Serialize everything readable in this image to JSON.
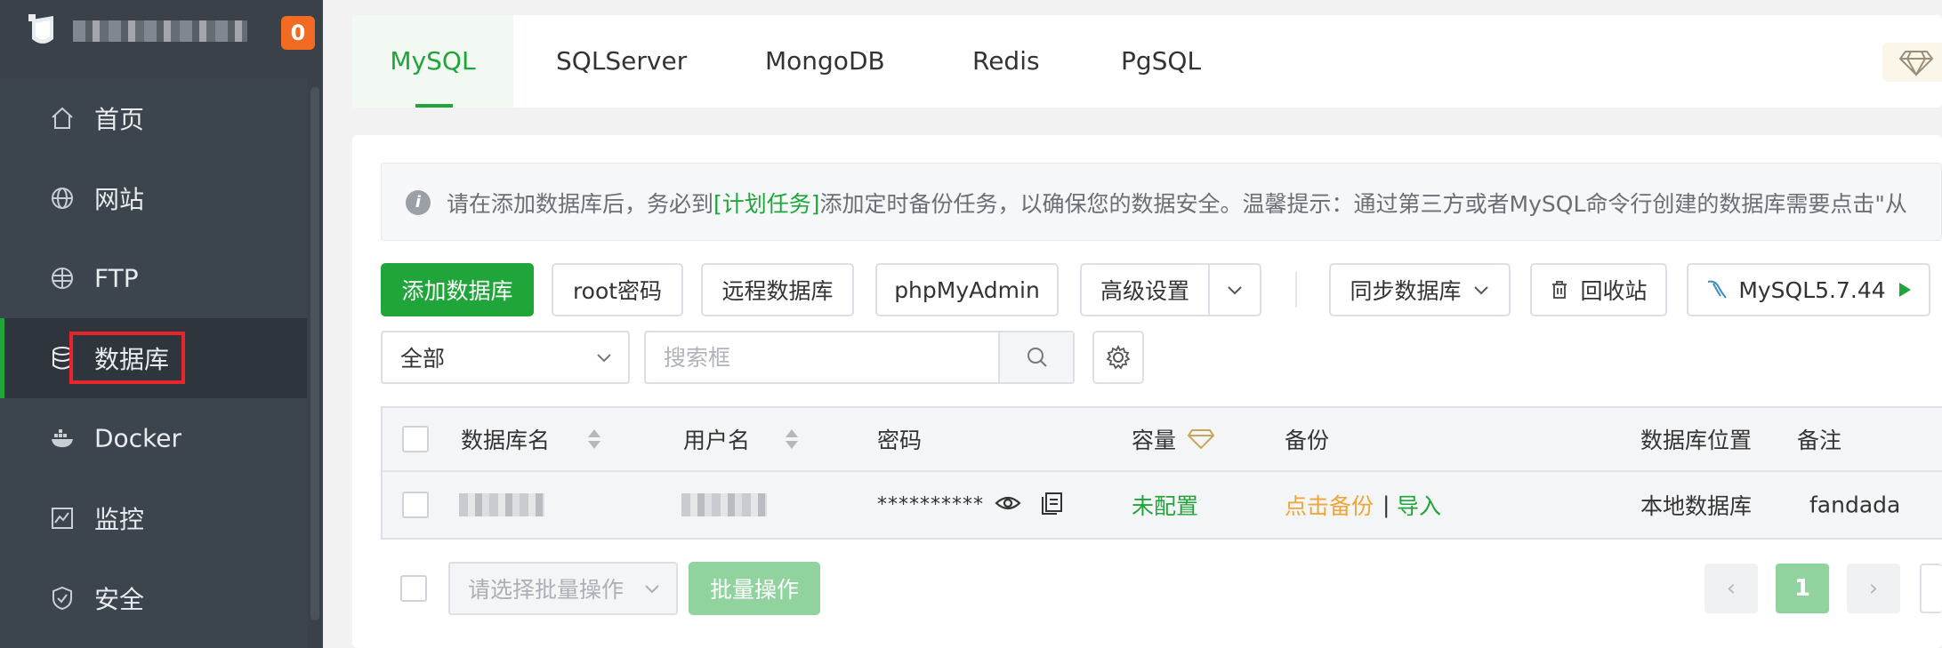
{
  "sidebar": {
    "badge": "0",
    "items": [
      {
        "label": "首页",
        "icon": "home-icon"
      },
      {
        "label": "网站",
        "icon": "globe-icon"
      },
      {
        "label": "FTP",
        "icon": "ftp-globe-icon"
      },
      {
        "label": "数据库",
        "icon": "database-icon",
        "active": true
      },
      {
        "label": "Docker",
        "icon": "docker-icon"
      },
      {
        "label": "监控",
        "icon": "monitor-chart-icon"
      },
      {
        "label": "安全",
        "icon": "shield-icon"
      }
    ]
  },
  "tabs": [
    {
      "label": "MySQL",
      "active": true
    },
    {
      "label": "SQLServer"
    },
    {
      "label": "MongoDB"
    },
    {
      "label": "Redis"
    },
    {
      "label": "PgSQL"
    }
  ],
  "notice": {
    "text_before": "请在添加数据库后，务必到",
    "link": "[计划任务]",
    "text_after": "添加定时备份任务，以确保您的数据安全。温馨提示：通过第三方或者MySQL命令行创建的数据库需要点击\"从"
  },
  "toolbar": {
    "add_db": "添加数据库",
    "root_pwd": "root密码",
    "remote_db": "远程数据库",
    "phpmyadmin": "phpMyAdmin",
    "advanced": "高级设置",
    "sync_db": "同步数据库",
    "recycle": "回收站",
    "version": "MySQL5.7.44"
  },
  "filter": {
    "scope": "全部",
    "search_placeholder": "搜索框"
  },
  "table": {
    "columns": [
      "数据库名",
      "用户名",
      "密码",
      "容量",
      "备份",
      "数据库位置",
      "备注"
    ],
    "rows": [
      {
        "password": "**********",
        "capacity": "未配置",
        "backup": "点击备份",
        "separator": "|",
        "import": "导入",
        "location": "本地数据库",
        "note": "fandada"
      }
    ]
  },
  "footer": {
    "batch_placeholder": "请选择批量操作",
    "batch_button": "批量操作",
    "current_page": "1",
    "prev": "‹",
    "next": "›"
  },
  "colors": {
    "accent": "#20a53a",
    "sidebar_bg": "#3c444d",
    "warning": "#f0a43a",
    "badge": "#f26b22",
    "highlight": "#e8262a"
  }
}
